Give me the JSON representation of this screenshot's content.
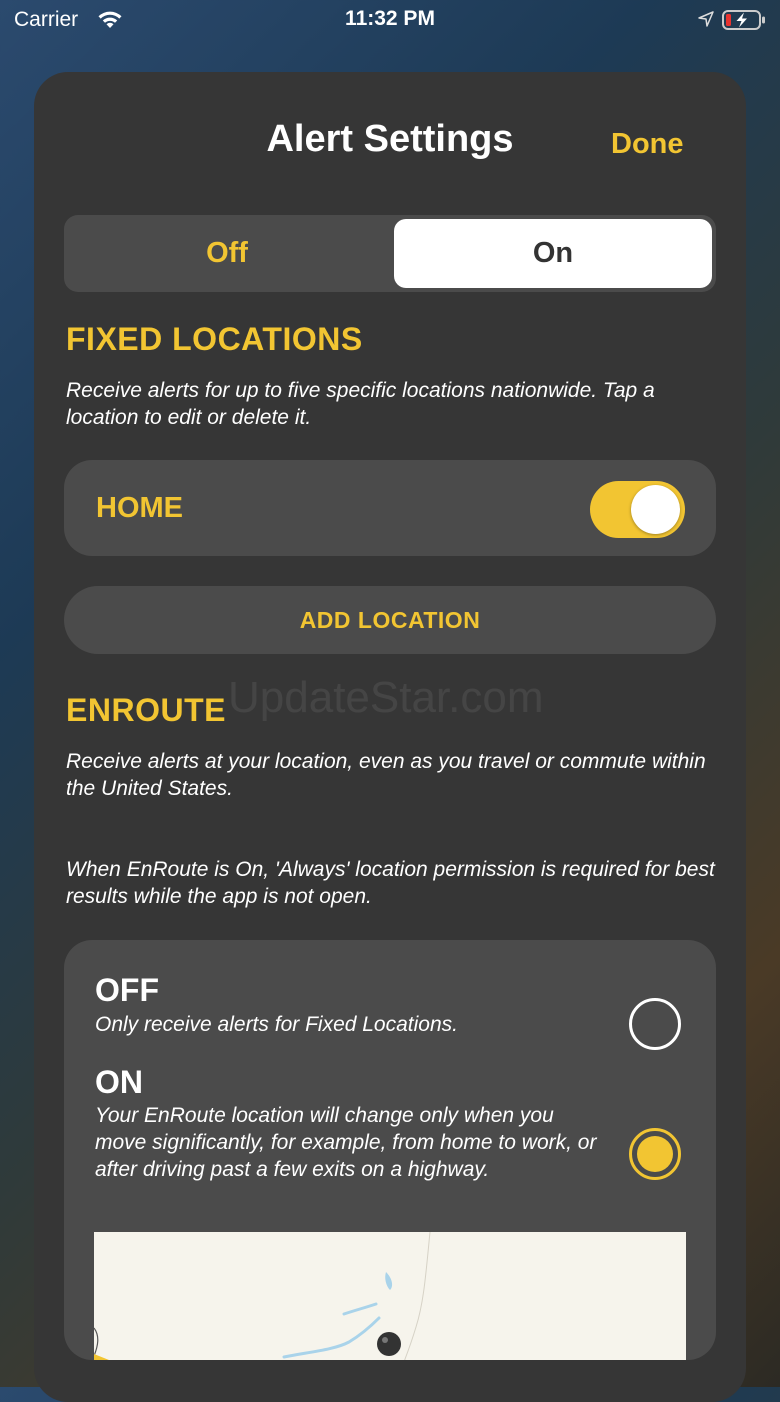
{
  "status_bar": {
    "carrier": "Carrier",
    "time": "11:32 PM"
  },
  "header": {
    "title": "Alert Settings",
    "done_label": "Done"
  },
  "alert_toggle": {
    "off_label": "Off",
    "on_label": "On",
    "selected": "On"
  },
  "fixed_locations": {
    "heading": "FIXED LOCATIONS",
    "description": "Receive alerts for up to five specific locations nationwide. Tap a location to edit or delete it.",
    "items": [
      {
        "label": "HOME",
        "enabled": true
      }
    ],
    "add_label": "ADD LOCATION"
  },
  "watermark": "UpdateStar.com",
  "enroute": {
    "heading": "ENROUTE",
    "description": "Receive alerts at your location, even as you travel or commute within the United States.",
    "note": "When EnRoute is On, 'Always' location permission is required for best results while the app is not open.",
    "options": [
      {
        "title": "OFF",
        "description": "Only receive alerts for Fixed Locations.",
        "selected": false
      },
      {
        "title": "ON",
        "description": "Your EnRoute location will change only when you move significantly, for example, from home to work, or after driving past a few exits on a highway.",
        "selected": true
      }
    ]
  },
  "colors": {
    "accent": "#f2c532",
    "sheet": "#363636",
    "card": "#4b4b4b"
  }
}
